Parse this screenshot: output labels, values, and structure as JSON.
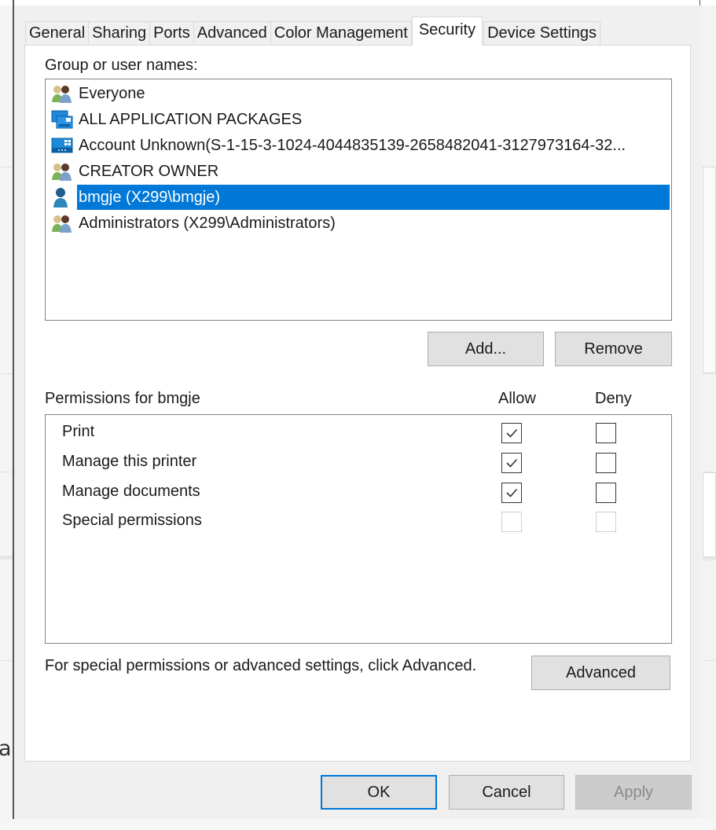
{
  "background": {
    "partial_text": "a"
  },
  "tabs": [
    {
      "label": "General",
      "active": false
    },
    {
      "label": "Sharing",
      "active": false
    },
    {
      "label": "Ports",
      "active": false
    },
    {
      "label": "Advanced",
      "active": false
    },
    {
      "label": "Color Management",
      "active": false
    },
    {
      "label": "Security",
      "active": true
    },
    {
      "label": "Device Settings",
      "active": false
    }
  ],
  "security": {
    "group_label": "Group or user names:",
    "users": [
      {
        "name": "Everyone",
        "icon": "group-icon",
        "selected": false
      },
      {
        "name": "ALL APPLICATION PACKAGES",
        "icon": "app-packages-icon",
        "selected": false
      },
      {
        "name": "Account Unknown(S-1-15-3-1024-4044835139-2658482041-3127973164-32...",
        "icon": "app-package-icon",
        "selected": false
      },
      {
        "name": "CREATOR OWNER",
        "icon": "group-icon",
        "selected": false
      },
      {
        "name": "bmgje (X299\\bmgje)",
        "icon": "user-icon",
        "selected": true
      },
      {
        "name": "Administrators (X299\\Administrators)",
        "icon": "group-icon",
        "selected": false
      }
    ],
    "add_button": "Add...",
    "remove_button": "Remove",
    "permissions_label": "Permissions for bmgje",
    "allow_header": "Allow",
    "deny_header": "Deny",
    "permissions": [
      {
        "name": "Print",
        "allow": true,
        "deny": false,
        "enabled": true
      },
      {
        "name": "Manage this printer",
        "allow": true,
        "deny": false,
        "enabled": true
      },
      {
        "name": "Manage documents",
        "allow": true,
        "deny": false,
        "enabled": true
      },
      {
        "name": "Special permissions",
        "allow": false,
        "deny": false,
        "enabled": false
      }
    ],
    "advanced_hint": "For special permissions or advanced settings, click Advanced.",
    "advanced_button": "Advanced"
  },
  "footer": {
    "ok": "OK",
    "cancel": "Cancel",
    "apply": "Apply",
    "apply_enabled": false
  },
  "colors": {
    "selection": "#0078d7",
    "dialog_bg": "#f0f0f0",
    "button_bg": "#e1e1e1"
  }
}
